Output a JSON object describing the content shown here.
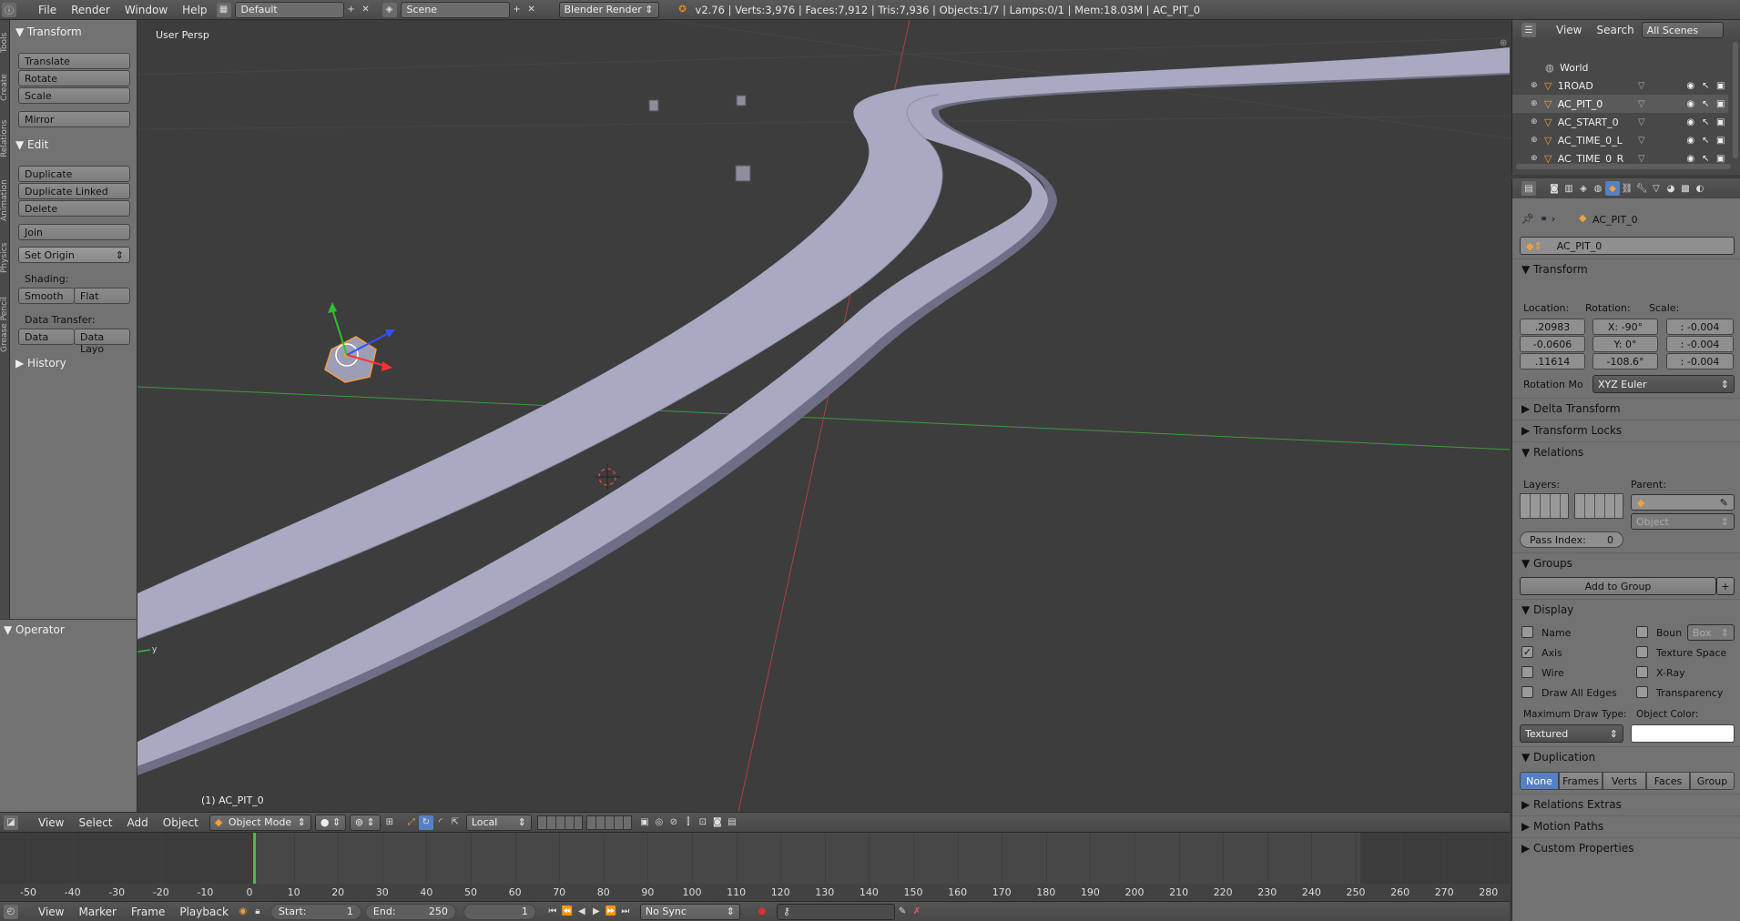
{
  "topbar": {
    "menus": [
      "File",
      "Render",
      "Window",
      "Help"
    ],
    "screen_layout": "Default",
    "scene": "Scene",
    "render_engine": "Blender Render",
    "stats": "v2.76 | Verts:3,976 | Faces:7,912 | Tris:7,936 | Objects:1/7 | Lamps:0/1 | Mem:18.03M | AC_PIT_0"
  },
  "tabs": [
    "Tools",
    "Create",
    "Relations",
    "Animation",
    "Physics",
    "Grease Pencil"
  ],
  "toolshelf": {
    "transform_title": "Transform",
    "translate": "Translate",
    "rotate": "Rotate",
    "scale": "Scale",
    "mirror": "Mirror",
    "edit_title": "Edit",
    "duplicate": "Duplicate",
    "duplicate_linked": "Duplicate Linked",
    "delete": "Delete",
    "join": "Join",
    "set_origin": "Set Origin",
    "shading_label": "Shading:",
    "smooth": "Smooth",
    "flat": "Flat",
    "data_transfer_label": "Data Transfer:",
    "data": "Data",
    "data_layout": "Data Layo",
    "history_title": "History",
    "operator_title": "Operator"
  },
  "viewport": {
    "view_label": "User Persp",
    "object_label": "(1) AC_PIT_0",
    "colors": {
      "road": "#a9a9c2",
      "x_axis": "#b04040",
      "y_axis": "#3f9b3f",
      "bg": "#3d3d3d",
      "select": "#f0a040"
    }
  },
  "viewport_header": {
    "menus": [
      "View",
      "Select",
      "Add",
      "Object"
    ],
    "mode": "Object Mode",
    "orientation": "Local"
  },
  "timeline": {
    "ticks": [
      "-50",
      "-40",
      "-30",
      "-20",
      "-10",
      "0",
      "10",
      "20",
      "30",
      "40",
      "50",
      "60",
      "70",
      "80",
      "90",
      "100",
      "110",
      "120",
      "130",
      "140",
      "150",
      "160",
      "170",
      "180",
      "190",
      "200",
      "210",
      "220",
      "230",
      "240",
      "250",
      "260",
      "270",
      "280"
    ],
    "current_frame": 1,
    "menus": [
      "View",
      "Marker",
      "Frame",
      "Playback"
    ],
    "start_label": "Start:",
    "start": "1",
    "end_label": "End:",
    "end": "250",
    "frame": "1",
    "sync": "No Sync"
  },
  "outliner": {
    "menus": [
      "View",
      "Search"
    ],
    "filter": "All Scenes",
    "items": [
      "World",
      "1ROAD",
      "AC_PIT_0",
      "AC_START_0",
      "AC_TIME_0_L",
      "AC_TIME_0_R"
    ]
  },
  "properties": {
    "breadcrumb": "AC_PIT_0",
    "object_name": "AC_PIT_0",
    "transform_title": "Transform",
    "location_label": "Location:",
    "rotation_label": "Rotation:",
    "scale_label": "Scale:",
    "location": [
      ".20983",
      "-0.0606",
      ".11614"
    ],
    "rotation": [
      "X:  -90°",
      "Y:      0°",
      "-108.6°"
    ],
    "scale": [
      ":  -0.004",
      ":  -0.004",
      ":  -0.004"
    ],
    "rotation_mode_label": "Rotation Mo",
    "rotation_mode": "XYZ Euler",
    "delta_transform": "Delta Transform",
    "transform_locks": "Transform Locks",
    "relations_title": "Relations",
    "layers_label": "Layers:",
    "parent_label": "Parent:",
    "parent_type": "Object",
    "pass_index_label": "Pass Index:",
    "pass_index": "0",
    "groups_title": "Groups",
    "add_to_group": "Add to Group",
    "display_title": "Display",
    "name": "Name",
    "bounds": "Boun",
    "bounds_type": "Box",
    "axis": "Axis",
    "texture_space": "Texture Space",
    "wire": "Wire",
    "xray": "X-Ray",
    "draw_all_edges": "Draw All Edges",
    "transparency": "Transparency",
    "max_draw_type_label": "Maximum Draw Type:",
    "object_color_label": "Object Color:",
    "max_draw_type": "Textured",
    "duplication_title": "Duplication",
    "dup_options": [
      "None",
      "Frames",
      "Verts",
      "Faces",
      "Group"
    ],
    "relations_extras": "Relations Extras",
    "motion_paths": "Motion Paths",
    "custom_properties": "Custom Properties"
  }
}
